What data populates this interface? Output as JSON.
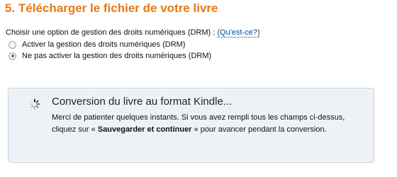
{
  "section": {
    "title": "5. Télécharger le fichier de votre livre"
  },
  "drm": {
    "question": "Choisir une option de gestion des droits numériques (DRM) : ",
    "help_link": "(Qu'est-ce?)",
    "options": [
      {
        "label": "Activer la gestion des droits numériques (DRM)",
        "selected": false
      },
      {
        "label": "Ne pas activer la gestion des droits numériques (DRM)",
        "selected": true
      }
    ]
  },
  "conversion": {
    "icon": "spinner-icon",
    "title": "Conversion du livre au format Kindle...",
    "message_before": "Merci de patienter quelques instants. Si vous avez rempli tous les champs ci-dessus, cliquez sur « ",
    "message_bold": "Sauvegarder et continuer",
    "message_after": " » pour avancer pendant la conversion."
  }
}
